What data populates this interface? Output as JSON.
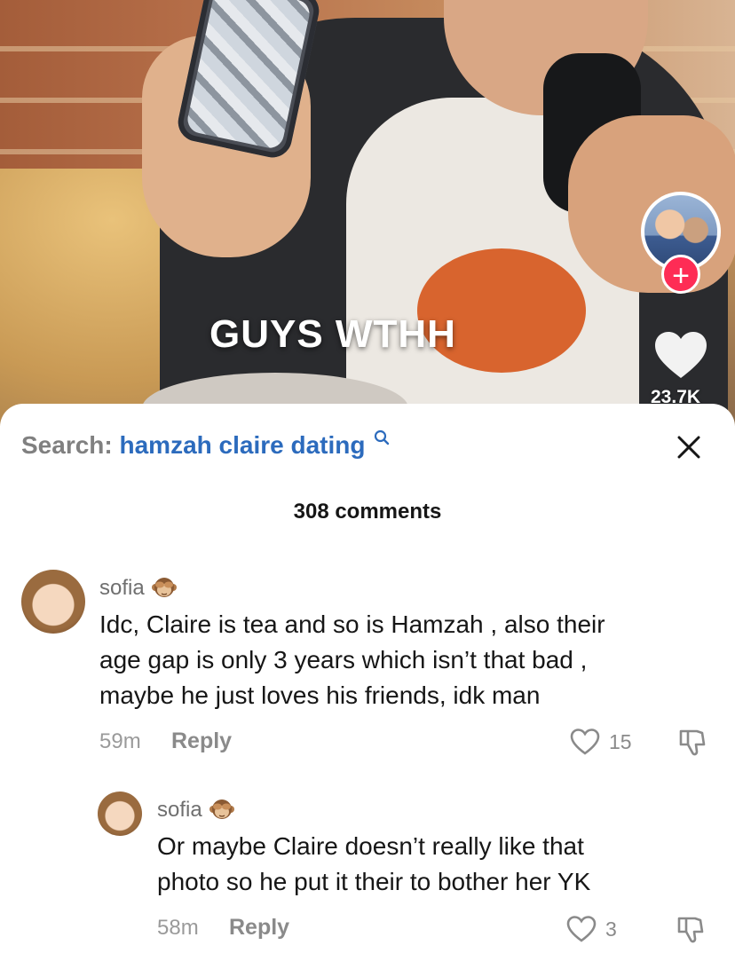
{
  "video": {
    "caption": "GUYS WTHH",
    "like_count": "23.7K",
    "follow_symbol": "+"
  },
  "comments_panel": {
    "search_label": "Search:",
    "search_term": "hamzah claire dating",
    "comment_count": "308 comments",
    "comments": [
      {
        "username": "sofia",
        "text_lines": [
          "Idc, Claire is tea and so is Hamzah , also their",
          "age gap is only 3 years which isn’t that bad ,",
          "maybe he just loves his friends, idk man"
        ],
        "time": "59m",
        "reply_label": "Reply",
        "likes": "15"
      },
      {
        "username": "sofia",
        "text_lines": [
          "Or maybe Claire doesn’t really like that",
          "photo so he put it their to bother her YK"
        ],
        "time": "58m",
        "reply_label": "Reply",
        "likes": "3"
      }
    ]
  },
  "icons": {
    "search": "search-icon",
    "close": "close-icon",
    "like": "heart-icon",
    "dislike": "dislike-icon",
    "emoji": "see-no-evil-monkey-icon"
  },
  "colors": {
    "accent_red": "#fe2c55",
    "search_term_blue": "#2c6bbd"
  }
}
